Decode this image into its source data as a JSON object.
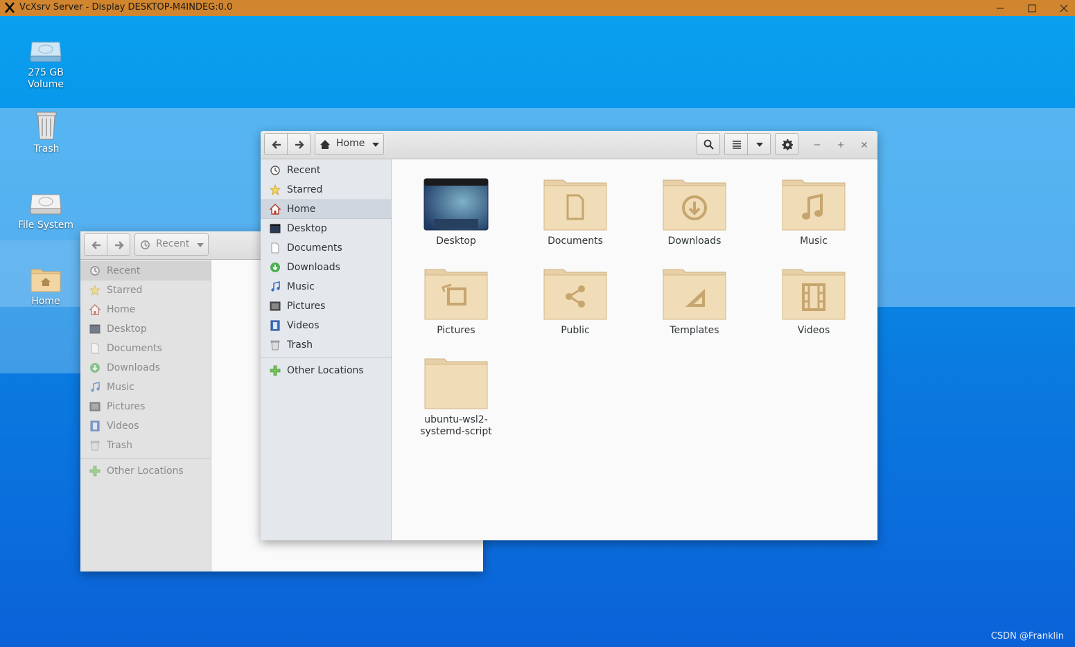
{
  "host_window": {
    "title": "VcXsrv Server - Display DESKTOP-M4INDEG:0.0",
    "titlebar_color": "#d0852e",
    "controls": [
      "minimize-icon",
      "maximize-icon",
      "close-icon"
    ]
  },
  "desktop": {
    "icons": [
      {
        "label": "275 GB\nVolume",
        "icon": "drive-icon"
      },
      {
        "label": "Trash",
        "icon": "trash-icon"
      },
      {
        "label": "File System",
        "icon": "drive-icon"
      },
      {
        "label": "Home",
        "icon": "home-folder-icon"
      }
    ]
  },
  "back_window": {
    "location": "Recent",
    "sidebar": {
      "items": [
        {
          "label": "Recent",
          "icon": "recent-icon"
        },
        {
          "label": "Starred",
          "icon": "star-icon"
        },
        {
          "label": "Home",
          "icon": "home-icon"
        },
        {
          "label": "Desktop",
          "icon": "desktop-icon"
        },
        {
          "label": "Documents",
          "icon": "document-icon"
        },
        {
          "label": "Downloads",
          "icon": "download-icon"
        },
        {
          "label": "Music",
          "icon": "music-icon"
        },
        {
          "label": "Pictures",
          "icon": "pictures-icon"
        },
        {
          "label": "Videos",
          "icon": "videos-icon"
        },
        {
          "label": "Trash",
          "icon": "trash-icon"
        }
      ],
      "other": {
        "label": "Other Locations",
        "icon": "plus-icon"
      }
    }
  },
  "front_window": {
    "location": "Home",
    "sidebar": {
      "items": [
        {
          "label": "Recent",
          "icon": "recent-icon"
        },
        {
          "label": "Starred",
          "icon": "star-icon"
        },
        {
          "label": "Home",
          "icon": "home-icon",
          "selected": true
        },
        {
          "label": "Desktop",
          "icon": "desktop-icon"
        },
        {
          "label": "Documents",
          "icon": "document-icon"
        },
        {
          "label": "Downloads",
          "icon": "download-icon"
        },
        {
          "label": "Music",
          "icon": "music-icon"
        },
        {
          "label": "Pictures",
          "icon": "pictures-icon"
        },
        {
          "label": "Videos",
          "icon": "videos-icon"
        },
        {
          "label": "Trash",
          "icon": "trash-icon"
        }
      ],
      "other": {
        "label": "Other Locations",
        "icon": "plus-icon"
      }
    },
    "files": [
      {
        "name": "Desktop",
        "icon": "desktop-folder-icon"
      },
      {
        "name": "Documents",
        "icon": "documents-folder-icon"
      },
      {
        "name": "Downloads",
        "icon": "downloads-folder-icon"
      },
      {
        "name": "Music",
        "icon": "music-folder-icon"
      },
      {
        "name": "Pictures",
        "icon": "pictures-folder-icon"
      },
      {
        "name": "Public",
        "icon": "public-folder-icon"
      },
      {
        "name": "Templates",
        "icon": "templates-folder-icon"
      },
      {
        "name": "Videos",
        "icon": "videos-folder-icon"
      },
      {
        "name": "ubuntu-wsl2-\nsystemd-script",
        "icon": "folder-icon"
      }
    ]
  },
  "watermark": "CSDN @Franklin"
}
